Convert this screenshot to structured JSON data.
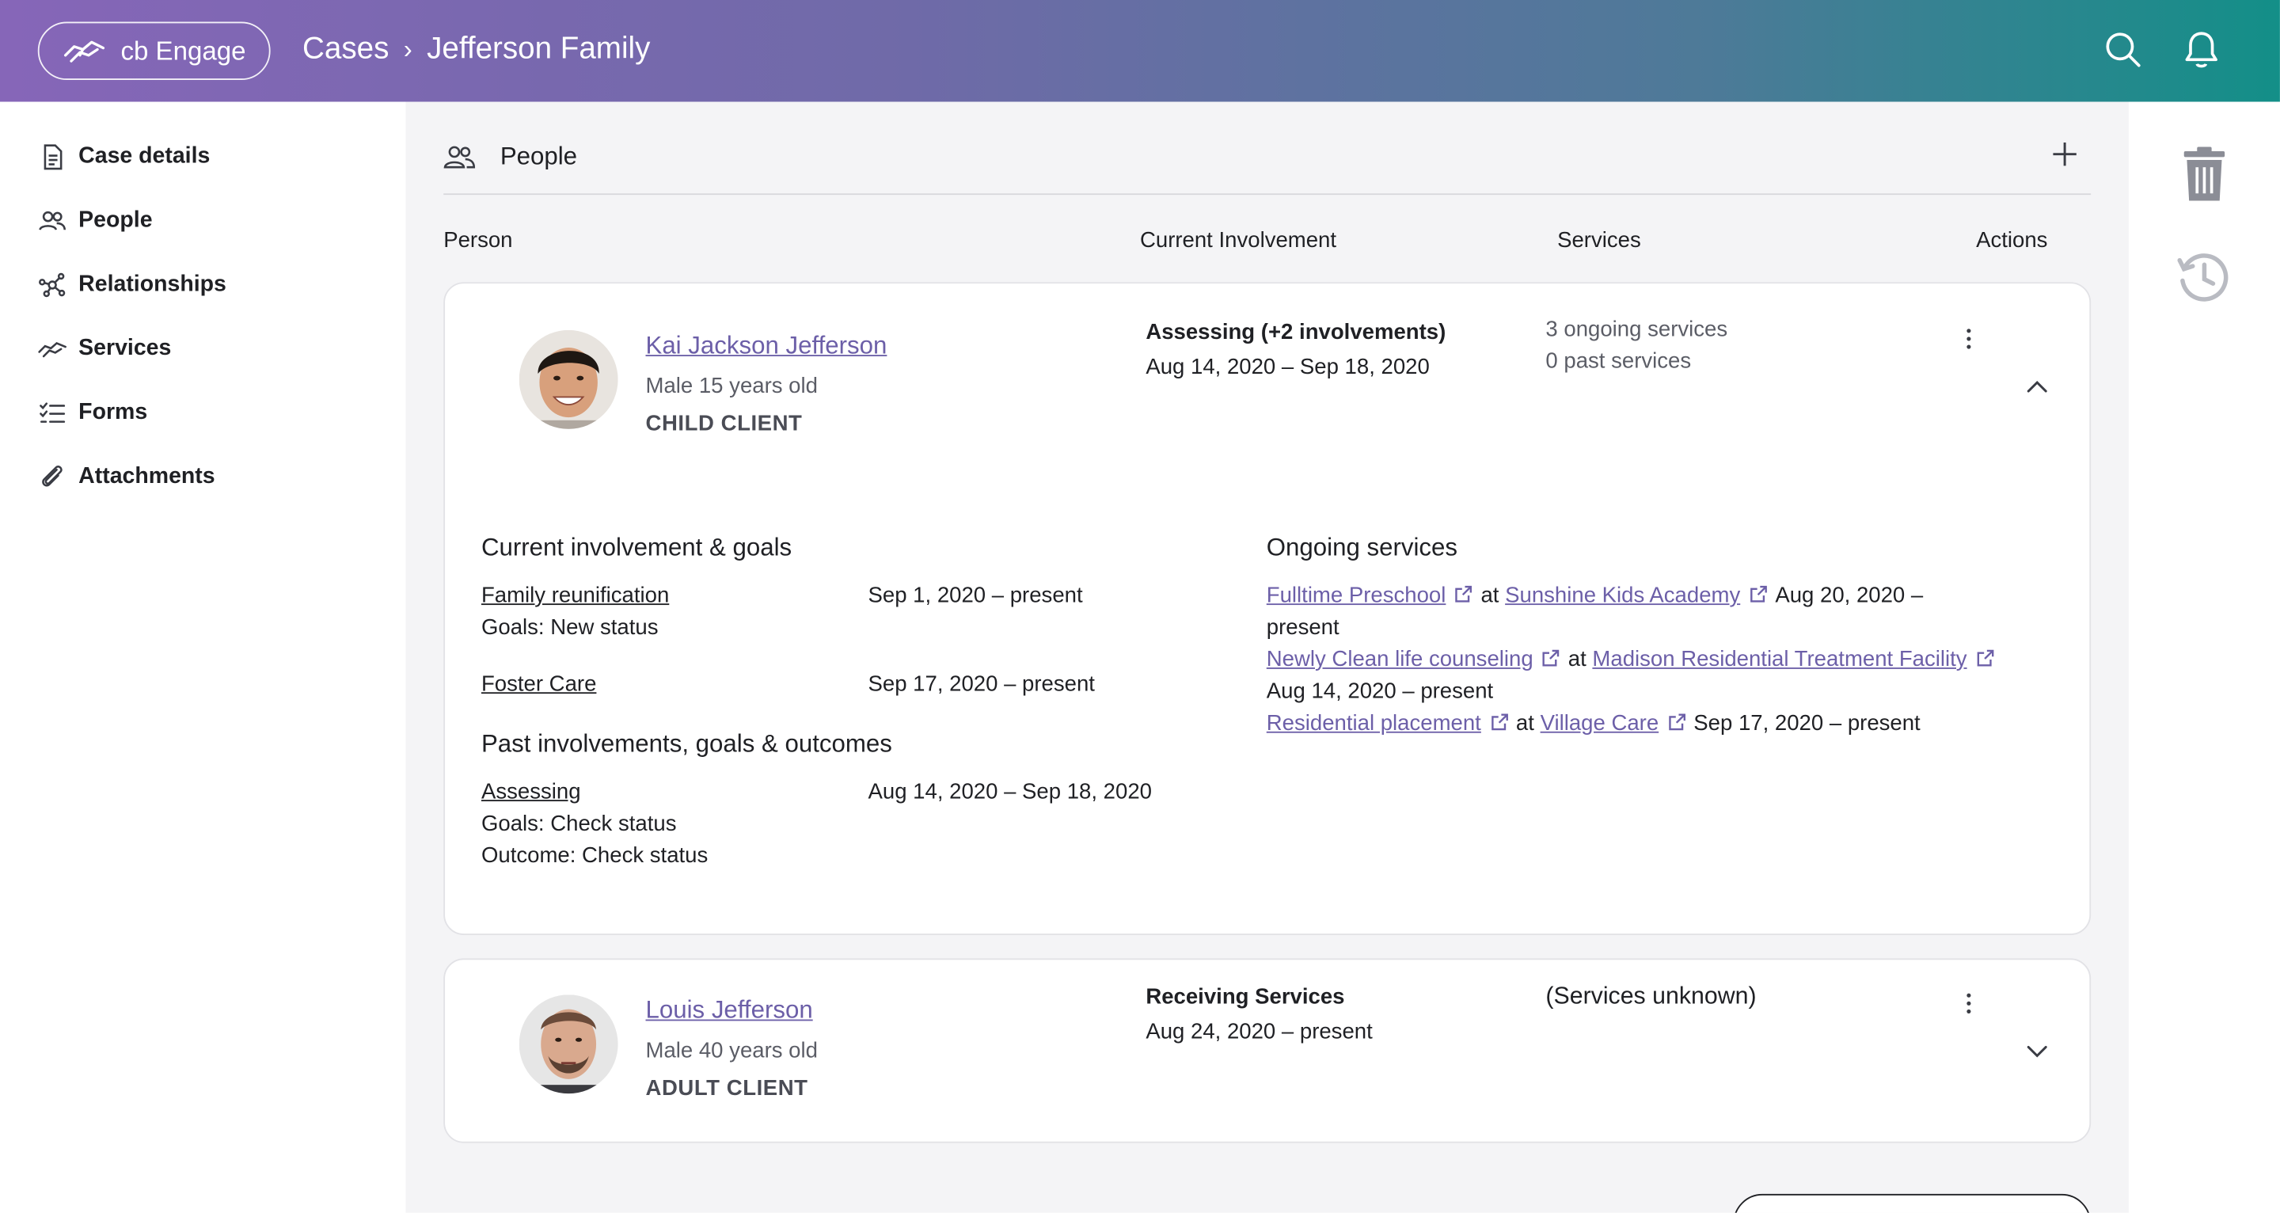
{
  "header": {
    "brand": "cb Engage",
    "breadcrumb_root": "Cases",
    "breadcrumb_separator": "›",
    "breadcrumb_current": "Jefferson Family"
  },
  "sidebar": {
    "items": [
      {
        "label": "Case details",
        "icon": "document-icon"
      },
      {
        "label": "People",
        "icon": "people-icon"
      },
      {
        "label": "Relationships",
        "icon": "network-icon"
      },
      {
        "label": "Services",
        "icon": "handshake-icon"
      },
      {
        "label": "Forms",
        "icon": "checklist-icon"
      },
      {
        "label": "Attachments",
        "icon": "paperclip-icon"
      }
    ]
  },
  "people_panel": {
    "title": "People",
    "columns": {
      "person": "Person",
      "involvement": "Current Involvement",
      "services": "Services",
      "actions": "Actions"
    }
  },
  "people": [
    {
      "name": "Kai Jackson Jefferson",
      "demographics": "Male 15 years old",
      "role": "CHILD CLIENT",
      "involvement_title": "Assessing (+2 involvements)",
      "involvement_dates": "Aug 14, 2020 – Sep 18, 2020",
      "ongoing_services": "3 ongoing services",
      "past_services": "0 past services",
      "details": {
        "current_heading": "Current involvement & goals",
        "current": [
          {
            "name": "Family reunification",
            "dates": "Sep 1, 2020 – present",
            "goals": "Goals: New status"
          },
          {
            "name": "Foster Care",
            "dates": "Sep 17, 2020 – present"
          }
        ],
        "past_heading": "Past involvements, goals & outcomes",
        "past": [
          {
            "name": "Assessing",
            "dates": "Aug 14, 2020 – Sep 18, 2020",
            "goals": "Goals: Check status",
            "outcome": "Outcome: Check status"
          }
        ],
        "services_heading": "Ongoing services",
        "services": [
          {
            "service": "Fulltime Preschool",
            "at": "at",
            "provider": "Sunshine Kids Academy",
            "dates_part1": "Aug 20, 2020 –",
            "dates_part2": "present"
          },
          {
            "service": "Newly Clean life counseling",
            "at": "at",
            "provider": "Madison Residential Treatment Facility",
            "dates": "Aug 14, 2020 – present"
          },
          {
            "service": "Residential placement",
            "at": "at",
            "provider": "Village Care",
            "dates": "Sep 17, 2020 – present"
          }
        ]
      }
    },
    {
      "name": "Louis Jefferson",
      "demographics": "Male 40 years old",
      "role": "ADULT CLIENT",
      "involvement_title": "Receiving Services",
      "involvement_dates": "Aug 24, 2020 – present",
      "services_text": "(Services unknown)"
    }
  ]
}
